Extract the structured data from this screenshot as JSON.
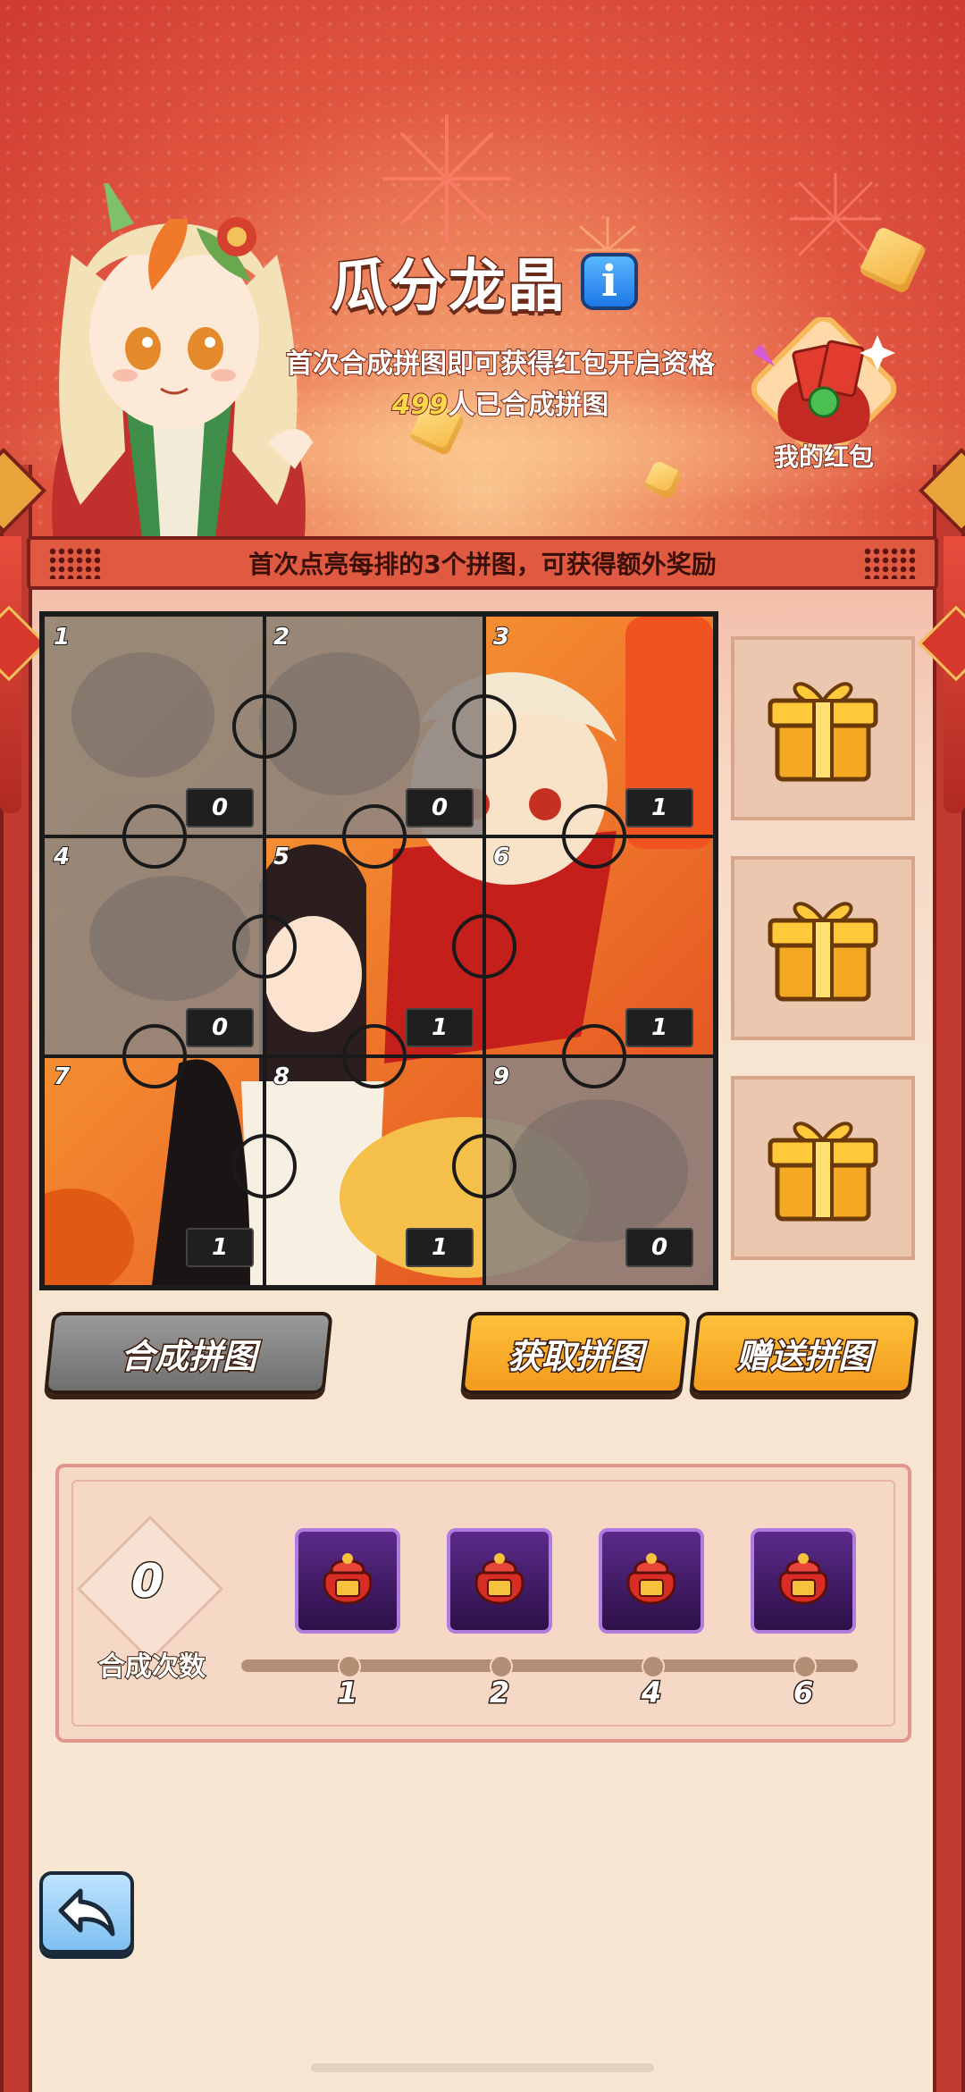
{
  "header": {
    "title": "瓜分龙晶",
    "info_icon": "i",
    "subtitle": "首次合成拼图即可获得红包开启资格",
    "participants_count": "499",
    "participants_suffix": "人已合成拼图",
    "my_redpack_label": "我的红包"
  },
  "banner": {
    "text": "首次点亮每排的3个拼图，可获得额外奖励"
  },
  "puzzle": {
    "pieces": [
      {
        "number": "1",
        "count": "0",
        "lit": false
      },
      {
        "number": "2",
        "count": "0",
        "lit": false
      },
      {
        "number": "3",
        "count": "1",
        "lit": true
      },
      {
        "number": "4",
        "count": "0",
        "lit": false
      },
      {
        "number": "5",
        "count": "1",
        "lit": true
      },
      {
        "number": "6",
        "count": "1",
        "lit": true
      },
      {
        "number": "7",
        "count": "1",
        "lit": true
      },
      {
        "number": "8",
        "count": "1",
        "lit": true
      },
      {
        "number": "9",
        "count": "0",
        "lit": false
      }
    ],
    "row_rewards": [
      "gift-box-icon",
      "gift-box-icon",
      "gift-box-icon"
    ]
  },
  "actions": {
    "combine": "合成拼图",
    "obtain": "获取拼图",
    "gift": "赠送拼图"
  },
  "progress": {
    "combine_count": "0",
    "combine_label": "合成次数",
    "milestones": [
      "1",
      "2",
      "4",
      "6"
    ],
    "milestone_icon": "lucky-bag-icon"
  },
  "colors": {
    "header_red": "#cf3a31",
    "accent_orange": "#f39a1c",
    "panel_bg": "#f8e6d3",
    "bag_purple": "#5a2a8a"
  }
}
